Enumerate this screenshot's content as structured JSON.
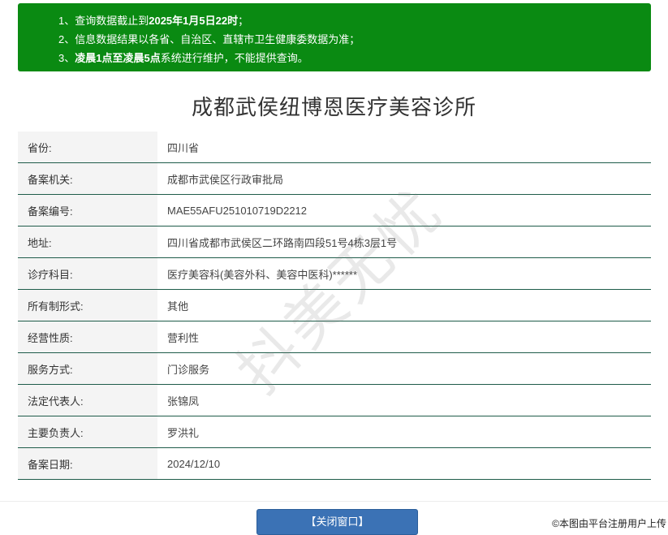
{
  "notice": {
    "line1_prefix": "1、查询数据截止到",
    "line1_bold": "2025年1月5日22时",
    "line1_suffix": "；",
    "line2": "2、信息数据结果以各省、自治区、直辖市卫生健康委数据为准；",
    "line3_prefix": "3、",
    "line3_bold": "凌晨1点至凌晨5点",
    "line3_suffix": "系统进行维护，不能提供查询。"
  },
  "title": "成都武侯纽博恩医疗美容诊所",
  "rows": [
    {
      "label": "省份:",
      "value": "四川省"
    },
    {
      "label": "备案机关:",
      "value": "成都市武侯区行政审批局"
    },
    {
      "label": "备案编号:",
      "value": "MAE55AFU251010719D2212"
    },
    {
      "label": "地址:",
      "value": "四川省成都市武侯区二环路南四段51号4栋3层1号"
    },
    {
      "label": "诊疗科目:",
      "value": "医疗美容科(美容外科、美容中医科)******"
    },
    {
      "label": "所有制形式:",
      "value": "其他"
    },
    {
      "label": "经营性质:",
      "value": "营利性"
    },
    {
      "label": "服务方式:",
      "value": "门诊服务"
    },
    {
      "label": "法定代表人:",
      "value": "张锦凤"
    },
    {
      "label": "主要负责人:",
      "value": "罗洪礼"
    },
    {
      "label": "备案日期:",
      "value": "2024/12/10"
    }
  ],
  "close_button": "【关闭窗口】",
  "watermark": "抖美无忧",
  "credit": "©本图由平台注册用户上传"
}
